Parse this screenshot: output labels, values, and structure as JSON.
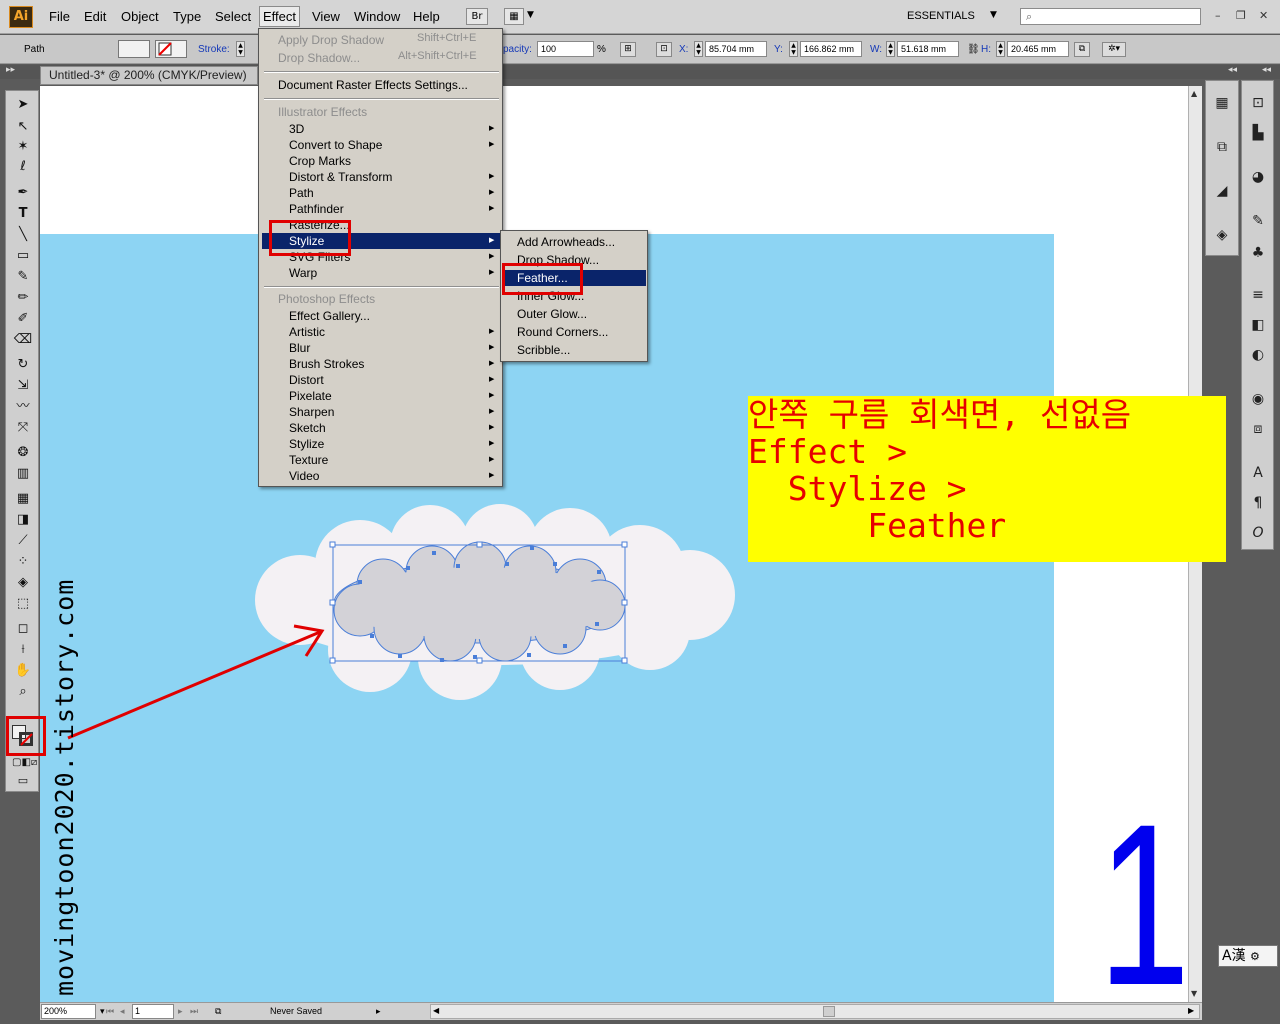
{
  "app": {
    "logo_text": "Ai",
    "menus": [
      "File",
      "Edit",
      "Object",
      "Type",
      "Select",
      "Effect",
      "View",
      "Window",
      "Help"
    ],
    "bridge_label": "Br",
    "workspace": "ESSENTIALS"
  },
  "control_bar": {
    "object_type": "Path",
    "stroke_label": "Stroke:",
    "opacity_label": "pacity:",
    "opacity_value": "100",
    "opacity_unit": "%",
    "x_label": "X:",
    "x_value": "85.704 mm",
    "y_label": "Y:",
    "y_value": "166.862 mm",
    "w_label": "W:",
    "w_value": "51.618 mm",
    "h_label": "H:",
    "h_value": "20.465 mm"
  },
  "document": {
    "tab_title": "Untitled-3* @ 200% (CMYK/Preview)"
  },
  "effect_menu": {
    "apply_last": "Apply Drop Shadow",
    "apply_last_shortcut": "Shift+Ctrl+E",
    "last_effect": "Drop Shadow...",
    "last_effect_shortcut": "Alt+Shift+Ctrl+E",
    "raster_settings": "Document Raster Effects Settings...",
    "illustrator_header": "Illustrator Effects",
    "illustrator_items": [
      "3D",
      "Convert to Shape",
      "Crop Marks",
      "Distort & Transform",
      "Path",
      "Pathfinder",
      "Rasterize...",
      "Stylize",
      "SVG Filters",
      "Warp"
    ],
    "photoshop_header": "Photoshop Effects",
    "photoshop_items": [
      "Effect Gallery...",
      "Artistic",
      "Blur",
      "Brush Strokes",
      "Distort",
      "Pixelate",
      "Sharpen",
      "Sketch",
      "Stylize",
      "Texture",
      "Video"
    ],
    "highlighted": "Stylize"
  },
  "stylize_submenu": {
    "items": [
      "Add Arrowheads...",
      "Drop Shadow...",
      "Feather...",
      "Inner Glow...",
      "Outer Glow...",
      "Round Corners...",
      "Scribble..."
    ],
    "highlighted": "Feather..."
  },
  "annotation": {
    "lines": [
      "안쪽 구름 회색면, 선없음",
      "Effect >",
      "  Stylize >",
      "      Feather"
    ],
    "step_number": "1",
    "watermark": "movingtoon2020.tistory.com"
  },
  "status_bar": {
    "zoom": "200%",
    "artboard": "1",
    "status": "Never Saved"
  },
  "ime": {
    "label": "A漢"
  },
  "colors": {
    "sky": "#8dd4f3",
    "cloud_outer": "#f4f1f4",
    "cloud_inner": "#d3d2d7",
    "selection": "#4a7ed8",
    "highlight": "#e00000",
    "note_bg": "#ffff00",
    "note_text": "#e60000",
    "step_number": "#0000ee",
    "menu_highlight": "#0a246a"
  }
}
